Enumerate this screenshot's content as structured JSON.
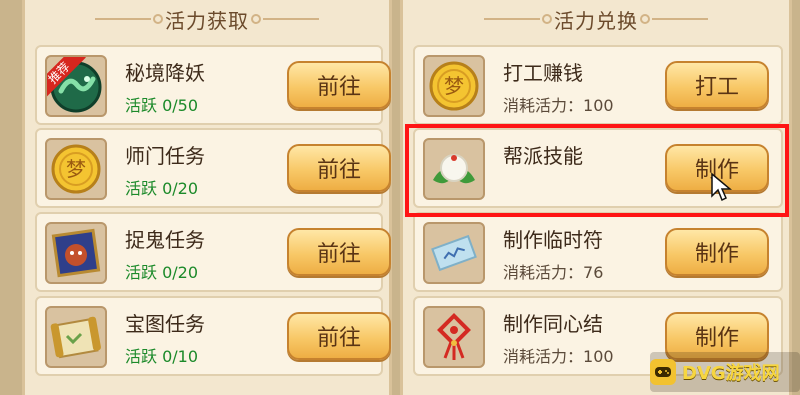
{
  "left_panel": {
    "title": "活力获取",
    "rows": [
      {
        "name": "秘境降妖",
        "activity_label": "活跃",
        "progress": "0/50",
        "button": "前往",
        "badge": "推荐",
        "icon": "dragon-orb-icon"
      },
      {
        "name": "师门任务",
        "activity_label": "活跃",
        "progress": "0/20",
        "button": "前往",
        "icon": "gold-coin-icon"
      },
      {
        "name": "捉鬼任务",
        "activity_label": "活跃",
        "progress": "0/20",
        "button": "前往",
        "icon": "ghost-scroll-icon"
      },
      {
        "name": "宝图任务",
        "activity_label": "活跃",
        "progress": "0/10",
        "button": "前往",
        "icon": "treasure-map-icon"
      }
    ]
  },
  "right_panel": {
    "title": "活力兑换",
    "rows": [
      {
        "name": "打工赚钱",
        "cost_label": "消耗活力：",
        "cost": "100",
        "button": "打工",
        "icon": "gold-coin-icon"
      },
      {
        "name": "帮派技能",
        "button": "制作",
        "icon": "rice-dumpling-icon"
      },
      {
        "name": "制作临时符",
        "cost_label": "消耗活力：",
        "cost": "76",
        "button": "制作",
        "icon": "talisman-icon"
      },
      {
        "name": "制作同心结",
        "cost_label": "消耗活力：",
        "cost": "100",
        "button": "制作",
        "icon": "chinese-knot-icon"
      }
    ]
  },
  "watermark": {
    "text": "DVG游戏网"
  },
  "colors": {
    "highlight": "#ff1414",
    "active_green": "#1c8a2a",
    "button_gold": "#f8c867"
  }
}
